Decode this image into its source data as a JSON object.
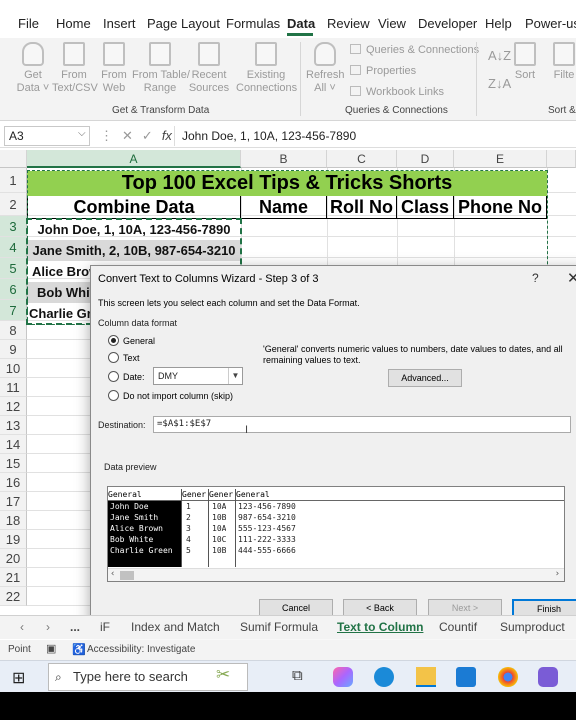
{
  "menu": {
    "items": [
      "File",
      "Home",
      "Insert",
      "Page Layout",
      "Formulas",
      "Data",
      "Review",
      "View",
      "Developer",
      "Help",
      "Power-use"
    ],
    "active": "Data"
  },
  "ribbon": {
    "get_data": "Get\nData ˅",
    "from_text": "From\nText/CSV",
    "from_web": "From\nWeb",
    "from_table": "From Table/\nRange",
    "recent": "Recent\nSources",
    "existing": "Existing\nConnections",
    "group1": "Get & Transform Data",
    "refresh": "Refresh\nAll ˅",
    "queries": "Queries & Connections",
    "properties": "Properties",
    "workbook_links": "Workbook Links",
    "group2": "Queries & Connections",
    "sort": "Sort",
    "filter": "Filte",
    "group3": "Sort &"
  },
  "formula_bar": {
    "name_box": "A3",
    "formula": "John Doe, 1, 10A, 123-456-7890"
  },
  "sheet": {
    "columns": [
      "A",
      "B",
      "C",
      "D",
      "E"
    ],
    "rows": [
      "1",
      "2",
      "3",
      "4",
      "5",
      "6",
      "7",
      "8",
      "9",
      "10",
      "11",
      "12",
      "13",
      "14",
      "15",
      "16",
      "17",
      "18",
      "19",
      "20",
      "21",
      "22"
    ],
    "title": "Top 100 Excel Tips & Tricks Shorts",
    "headers": {
      "a": "Combine Data",
      "b": "Name",
      "c": "Roll No",
      "d": "Class",
      "e": "Phone No"
    },
    "a3": "John Doe, 1, 10A, 123-456-7890",
    "a4": "Jane Smith, 2, 10B, 987-654-3210",
    "a5": "Alice Brow",
    "a6": "Bob Whit",
    "a7": "Charlie Gre"
  },
  "dialog": {
    "title": "Convert Text to Columns Wizard - Step 3 of 3",
    "help": "?",
    "close": "✕",
    "intro": "This screen lets you select each column and set the Data Format.",
    "format_group": "Column data format",
    "opt_general": "General",
    "opt_text": "Text",
    "opt_date": "Date:",
    "date_value": "DMY",
    "opt_skip": "Do not import column (skip)",
    "general_desc": "'General' converts numeric values to numbers, date values to dates, and all remaining values to text.",
    "advanced": "Advanced...",
    "dest_label": "Destination:",
    "dest_value": "=$A$1:$E$7",
    "preview_label": "Data preview",
    "preview": {
      "headers": [
        "General",
        "Gener",
        "Gener",
        "General"
      ],
      "col1": [
        "John Doe",
        "Jane Smith",
        "Alice Brown",
        "Bob White",
        "Charlie Green"
      ],
      "col2": [
        "1",
        "2",
        "3",
        "4",
        "5"
      ],
      "col3": [
        "10A",
        "10B",
        "10A",
        "10C",
        "10B"
      ],
      "col4": [
        "123-456-7890",
        "987-654-3210",
        "555-123-4567",
        "111-222-3333",
        "444-555-6666"
      ]
    },
    "cancel": "Cancel",
    "back": "< Back",
    "next": "Next >",
    "finish": "Finish"
  },
  "sheet_tabs": {
    "items": [
      "iF",
      "Index and Match",
      "Sumif Formula",
      "Text to Column",
      "Countif",
      "Sumproduct"
    ],
    "active": "Text to Column",
    "ellipsis": "..."
  },
  "status": {
    "mode": "Point",
    "accessibility": "Accessibility: Investigate"
  },
  "taskbar": {
    "search": "Type here to search"
  },
  "colors": {
    "excel_green": "#217346",
    "title_fill": "#92d050",
    "accent": "#0078d7"
  }
}
